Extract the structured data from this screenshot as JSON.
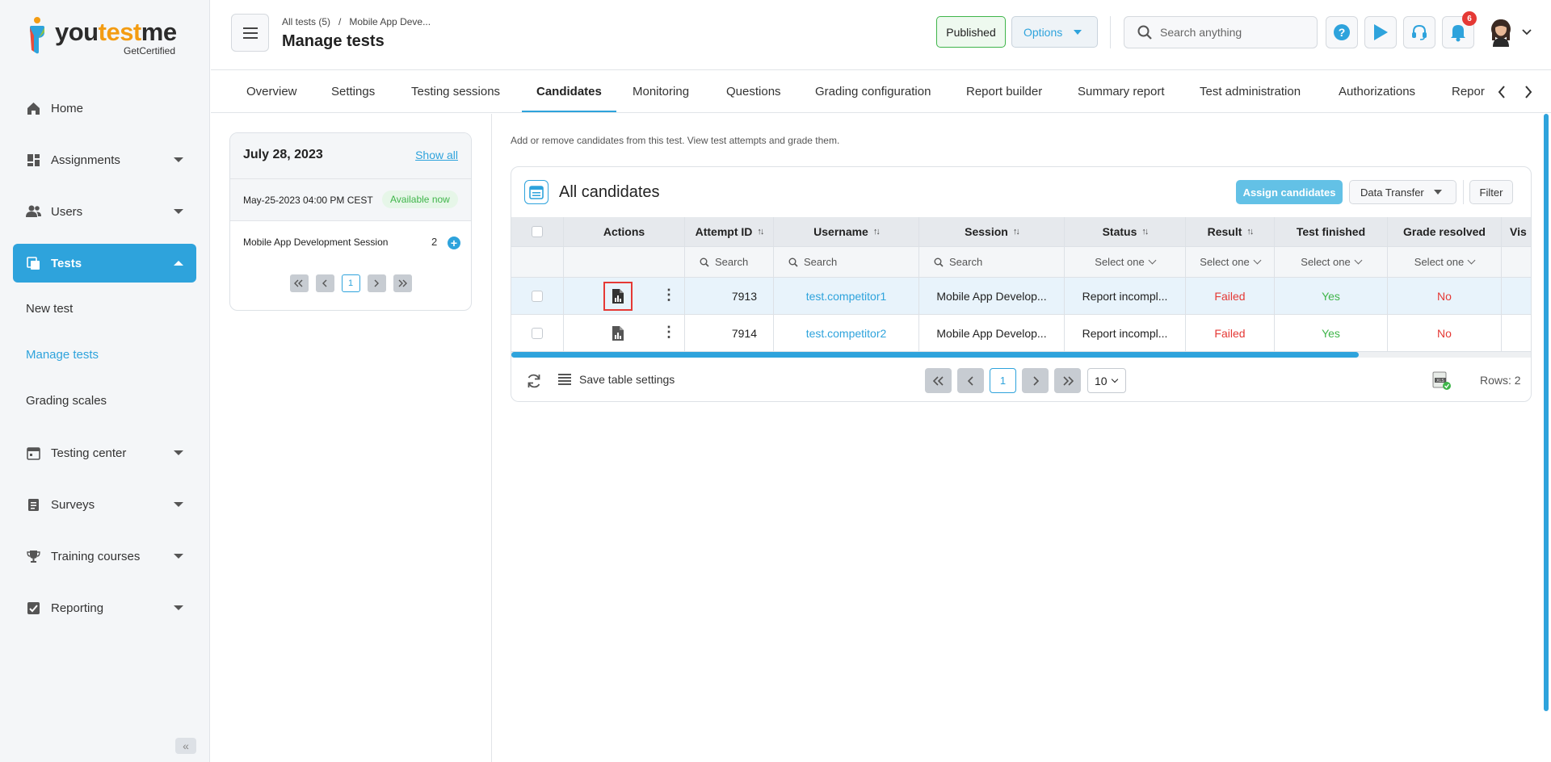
{
  "brand": {
    "logo_text_1": "you",
    "logo_text_2": "test",
    "logo_text_3": "me",
    "tagline": "GetCertified",
    "accent": "#2ea3dc"
  },
  "sidebar": {
    "items": [
      {
        "label": "Home",
        "icon": "home-icon"
      },
      {
        "label": "Assignments",
        "icon": "assignments-icon"
      },
      {
        "label": "Users",
        "icon": "users-icon"
      },
      {
        "label": "Tests",
        "icon": "tests-icon",
        "active": true
      },
      {
        "label": "Testing center",
        "icon": "calendar-icon"
      },
      {
        "label": "Surveys",
        "icon": "surveys-icon"
      },
      {
        "label": "Training courses",
        "icon": "trophy-icon"
      },
      {
        "label": "Reporting",
        "icon": "reporting-icon"
      }
    ],
    "sub_items": [
      "New test",
      "Manage tests",
      "Grading scales"
    ],
    "collapse_glyph": "«"
  },
  "header": {
    "breadcrumb": [
      "All tests (5)",
      "Mobile App Deve..."
    ],
    "breadcrumb_sep": "/",
    "title": "Manage tests",
    "published_label": "Published",
    "options_label": "Options",
    "search_placeholder": "Search anything",
    "notification_count": "6"
  },
  "tabs": [
    "Overview",
    "Settings",
    "Testing sessions",
    "Candidates",
    "Monitoring",
    "Questions",
    "Grading configuration",
    "Report builder",
    "Summary report",
    "Test administration",
    "Authorizations",
    "Repor"
  ],
  "active_tab": "Candidates",
  "session_panel": {
    "date": "July 28, 2023",
    "show_all": "Show all",
    "session_time": "May-25-2023 04:00 PM CEST",
    "availability": "Available now",
    "session_name": "Mobile App Development Session",
    "session_count": "2",
    "plus": "+",
    "page": "1"
  },
  "main": {
    "intro": "Add or remove candidates from this test. View test attempts and grade them.",
    "card_title": "All candidates",
    "assign_label": "Assign candidates",
    "transfer_label": "Data Transfer",
    "filter_label": "Filter"
  },
  "table": {
    "columns": [
      "Actions",
      "Attempt ID",
      "Username",
      "Session",
      "Status",
      "Result",
      "Test finished",
      "Grade resolved",
      "Vis"
    ],
    "sort_glyph": "↑↓",
    "search_placeholder": "Search",
    "select_placeholder": "Select one",
    "rows": [
      {
        "attempt_id": "7913",
        "username": "test.competitor1",
        "session": "Mobile App Develop...",
        "status": "Report incompl...",
        "result": "Failed",
        "test_finished": "Yes",
        "grade_resolved": "No"
      },
      {
        "attempt_id": "7914",
        "username": "test.competitor2",
        "session": "Mobile App Develop...",
        "status": "Report incompl...",
        "result": "Failed",
        "test_finished": "Yes",
        "grade_resolved": "No"
      }
    ],
    "horizontal_scroll_fraction": 0.83
  },
  "footer": {
    "save_settings": "Save table settings",
    "page": "1",
    "per_page": "10",
    "rows_label": "Rows: 2"
  }
}
